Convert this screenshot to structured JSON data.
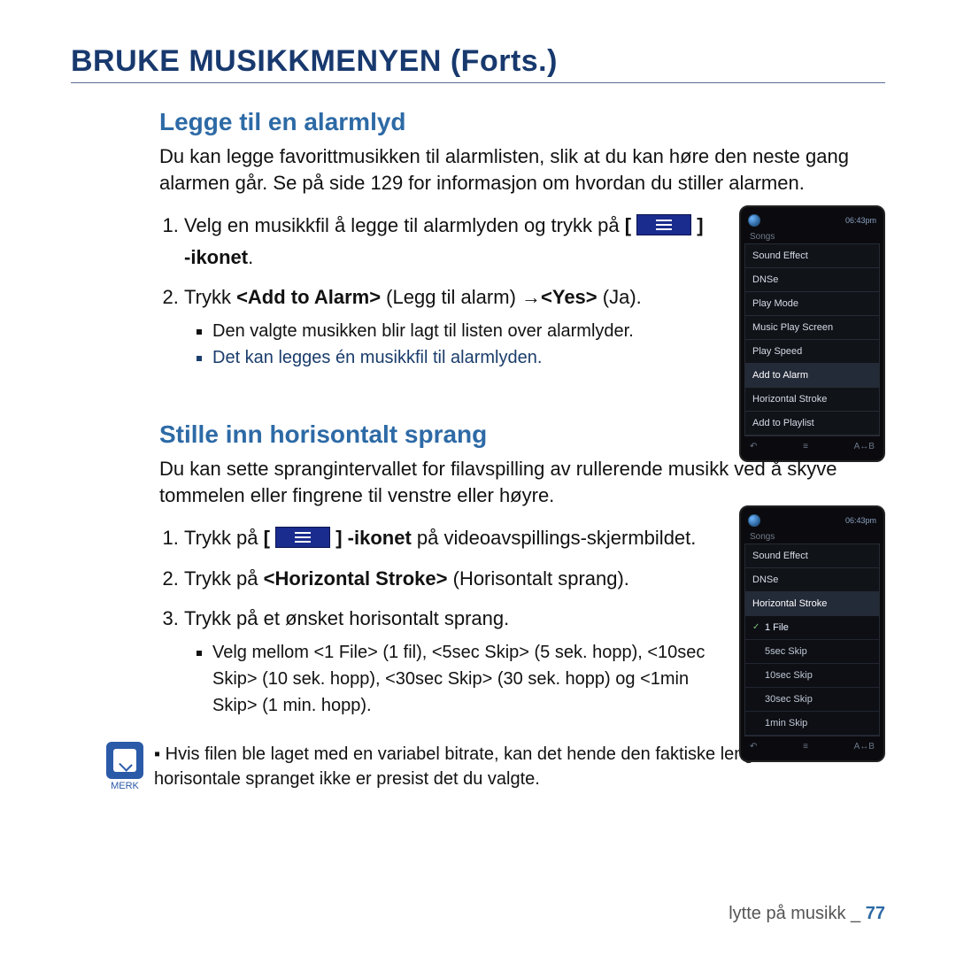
{
  "pageTitle": "BRUKE MUSIKKMENYEN (Forts.)",
  "section1": {
    "title": "Legge til en alarmlyd",
    "lead": "Du kan legge favorittmusikken til alarmlisten, slik at du kan høre den neste gang alarmen går. Se på side 129 for informasjon om hvordan du stiller alarmen.",
    "step1_a": "Velg en musikkfil å legge til alarmlyden og trykk på ",
    "step1_b": "[",
    "step1_c": "] -ikonet",
    "step1_d": ".",
    "step2_a": "Trykk ",
    "step2_b": "<Add to Alarm>",
    "step2_c": " (Legg til alarm) →",
    "step2_d": "<Yes>",
    "step2_e": " (Ja).",
    "sub1": "Den valgte musikken blir lagt til listen over alarmlyder.",
    "sub2": "Det kan legges én musikkfil til alarmlyden."
  },
  "section2": {
    "title": "Stille inn horisontalt sprang",
    "lead": "Du kan sette sprangintervallet for filavspilling av rullerende musikk ved å skyve tommelen eller fingrene til venstre eller høyre.",
    "step1_a": "Trykk på ",
    "step1_b": "[",
    "step1_c": "] -ikonet",
    "step1_d": " på videoavspillings-skjermbildet.",
    "step2_a": "Trykk på ",
    "step2_b": "<Horizontal Stroke>",
    "step2_c": " (Horisontalt sprang).",
    "step3": "Trykk på et ønsket horisontalt sprang.",
    "sub": "Velg mellom <1 File> (1 fil), <5sec Skip> (5 sek. hopp), <10sec Skip> (10 sek. hopp), <30sec Skip> (30 sek. hopp) og <1min Skip> (1 min. hopp)."
  },
  "note": {
    "label": "MERK",
    "text": "Hvis filen ble laget med en variabel bitrate, kan det hende den faktiske lengde av det horisontale spranget ikke er presist det du valgte."
  },
  "device1": {
    "time": "06:43pm",
    "screenTitle": "Songs",
    "items": [
      "Sound Effect",
      "DNSe",
      "Play Mode",
      "Music Play Screen",
      "Play Speed",
      "Add to Alarm",
      "Horizontal Stroke",
      "Add to Playlist"
    ],
    "selected": "Add to Alarm",
    "soft_center": "≡",
    "soft_right": "A↔B"
  },
  "device2": {
    "time": "06:43pm",
    "screenTitle": "Songs",
    "topItems": [
      "Sound Effect",
      "DNSe"
    ],
    "selected": "Horizontal Stroke",
    "subItems": [
      "1 File",
      "5sec Skip",
      "10sec Skip",
      "30sec Skip",
      "1min Skip"
    ],
    "current": "1 File",
    "soft_center": "≡",
    "soft_right": "A↔B"
  },
  "footer": {
    "text": "lytte på musikk _ ",
    "page": "77"
  }
}
